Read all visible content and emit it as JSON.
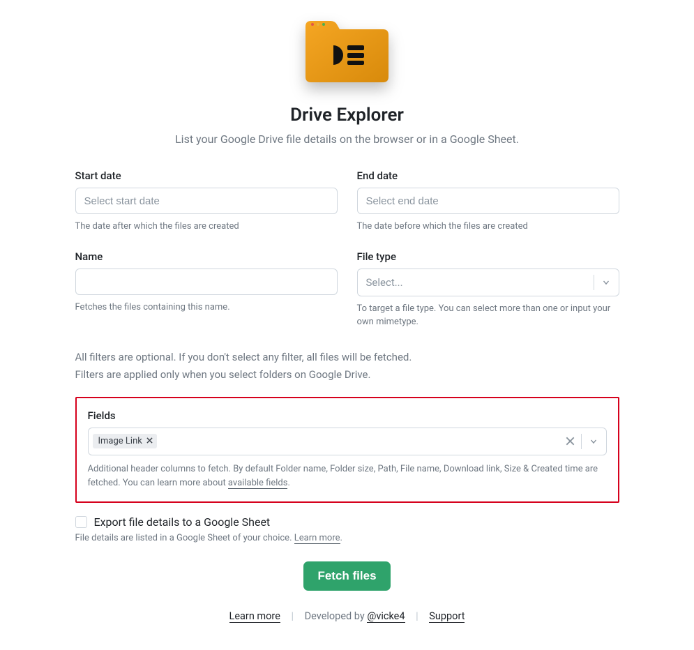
{
  "header": {
    "title": "Drive Explorer",
    "subtitle": "List your Google Drive file details on the browser or in a Google Sheet."
  },
  "filters": {
    "start_date": {
      "label": "Start date",
      "placeholder": "Select start date",
      "help": "The date after which the files are created"
    },
    "end_date": {
      "label": "End date",
      "placeholder": "Select end date",
      "help": "The date before which the files are created"
    },
    "name": {
      "label": "Name",
      "help": "Fetches the files containing this name."
    },
    "file_type": {
      "label": "File type",
      "placeholder": "Select...",
      "help": "To target a file type. You can select more than one or input your own mimetype."
    }
  },
  "notes": {
    "line1": "All filters are optional. If you don't select any filter, all files will be fetched.",
    "line2": "Filters are applied only when you select folders on Google Drive."
  },
  "fields": {
    "label": "Fields",
    "chip": "Image Link",
    "help_prefix": "Additional header columns to fetch. By default Folder name, Folder size, Path, File name, Download link, Size & Created time are fetched. You can learn more about ",
    "help_link": "available fields",
    "help_suffix": "."
  },
  "export": {
    "label": "Export file details to a Google Sheet",
    "help_prefix": "File details are listed in a Google Sheet of your choice. ",
    "help_link": "Learn more",
    "help_suffix": "."
  },
  "actions": {
    "fetch": "Fetch files"
  },
  "footer": {
    "learn": "Learn more",
    "developed": "Developed by ",
    "author": "@vicke4",
    "support": "Support"
  }
}
